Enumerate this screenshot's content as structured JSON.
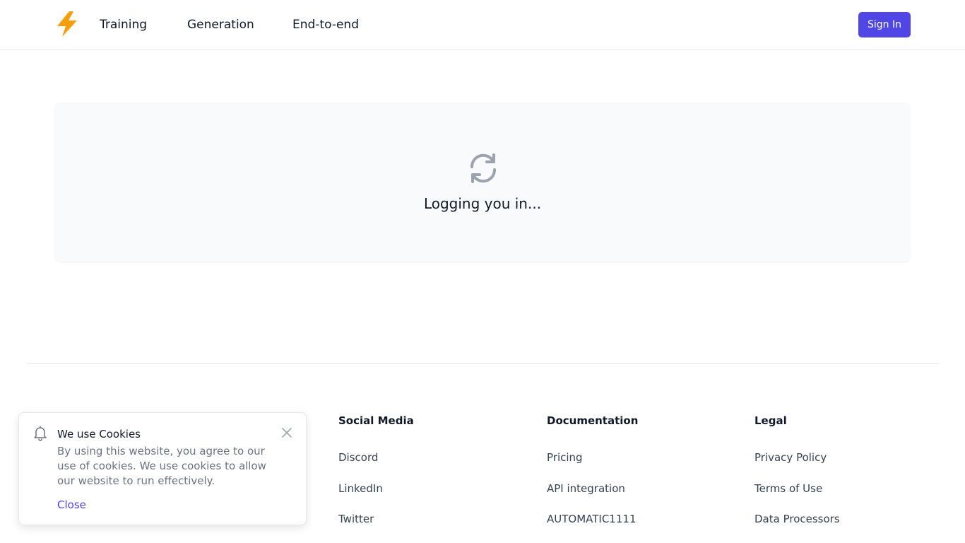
{
  "nav": {
    "logo_icon": "lightning-bolt-icon",
    "links": [
      "Training",
      "Generation",
      "End-to-end"
    ],
    "signin_label": "Sign In"
  },
  "main": {
    "status_icon": "refresh-icon",
    "status_text": "Logging you in..."
  },
  "footer": {
    "columns": [
      {
        "heading": "Social Media",
        "links": [
          "Discord",
          "LinkedIn",
          "Twitter"
        ]
      },
      {
        "heading": "Documentation",
        "links": [
          "Pricing",
          "API integration",
          "AUTOMATIC1111"
        ]
      },
      {
        "heading": "Legal",
        "links": [
          "Privacy Policy",
          "Terms of Use",
          "Data Processors"
        ]
      }
    ]
  },
  "cookie": {
    "icon": "bell-icon",
    "title": "We use Cookies",
    "body": "By using this website, you agree to our use of cookies. We use cookies to allow our website to run effectively.",
    "close_label": "Close"
  },
  "colors": {
    "accent": "#4f46e5",
    "logo": "#f59e0b",
    "card_bg": "#f9fafb",
    "icon_gray": "#9ca3af"
  }
}
